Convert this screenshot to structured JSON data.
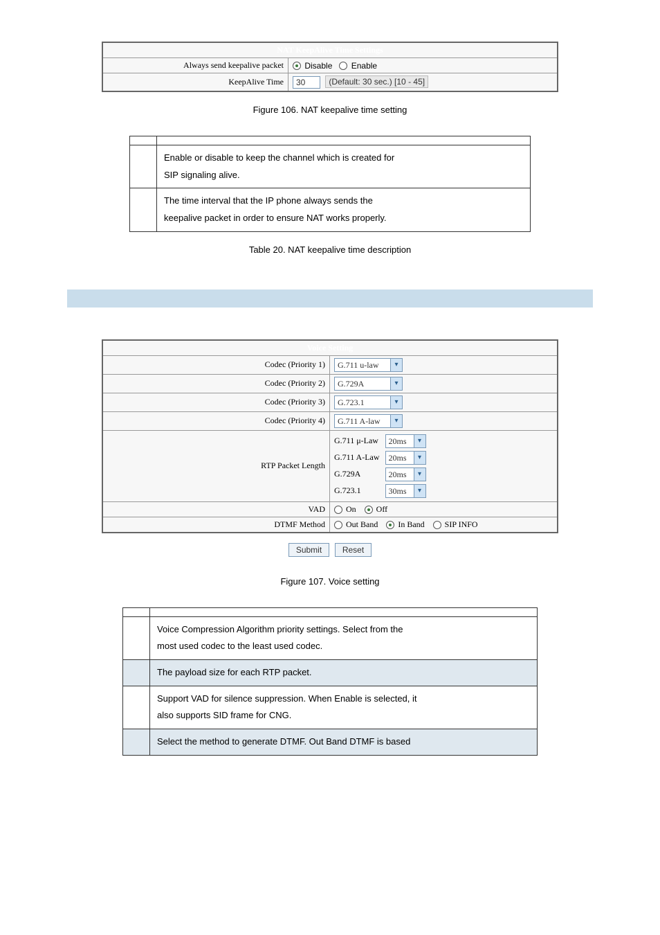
{
  "nat_settings": {
    "title": "NAT KeepAlive Time Settings",
    "row1_label": "Always send keepalive packet",
    "row1_opt_disable": "Disable",
    "row1_opt_enable": "Enable",
    "row2_label": "KeepAlive Time",
    "row2_value": "30",
    "row2_hint": "(Default: 30 sec.) [10 - 45]"
  },
  "fig106": "Figure 106. NAT keepalive time setting",
  "nat_desc": {
    "r1_desc_l1": "Enable or disable to keep the channel which is created for",
    "r1_desc_l2": "SIP signaling alive.",
    "r2_desc_l1": "The time interval that the IP phone always sends the",
    "r2_desc_l2": "keepalive packet in order to ensure NAT works properly."
  },
  "tab20": "Table 20. NAT keepalive time description",
  "voice": {
    "title": "Voice Setting",
    "codec_p1_label": "Codec (Priority 1)",
    "codec_p1_val": "G.711 u-law",
    "codec_p2_label": "Codec (Priority 2)",
    "codec_p2_val": "G.729A",
    "codec_p3_label": "Codec (Priority 3)",
    "codec_p3_val": "G.723.1",
    "codec_p4_label": "Codec (Priority 4)",
    "codec_p4_val": "G.711 A-law",
    "rtp_label": "RTP Packet Length",
    "rtp_r1_name": "G.711 μ-Law",
    "rtp_r1_val": "20ms",
    "rtp_r2_name": "G.711 A-Law",
    "rtp_r2_val": "20ms",
    "rtp_r3_name": "G.729A",
    "rtp_r3_val": "20ms",
    "rtp_r4_name": "G.723.1",
    "rtp_r4_val": "30ms",
    "vad_label": "VAD",
    "vad_on": "On",
    "vad_off": "Off",
    "dtmf_label": "DTMF Method",
    "dtmf_out": "Out Band",
    "dtmf_in": "In Band",
    "dtmf_sip": "SIP INFO",
    "submit": "Submit",
    "reset": "Reset"
  },
  "fig107": "Figure 107. Voice setting",
  "voice_desc": {
    "r1_l1": "Voice Compression Algorithm priority settings. Select from the",
    "r1_l2": "most used codec to the least used codec.",
    "r2": "The payload size for each RTP packet.",
    "r3_l1": "Support VAD for silence suppression. When Enable is selected, it",
    "r3_l2": "also supports SID frame for CNG.",
    "r4": "Select the method to generate DTMF. Out Band DTMF is based"
  }
}
